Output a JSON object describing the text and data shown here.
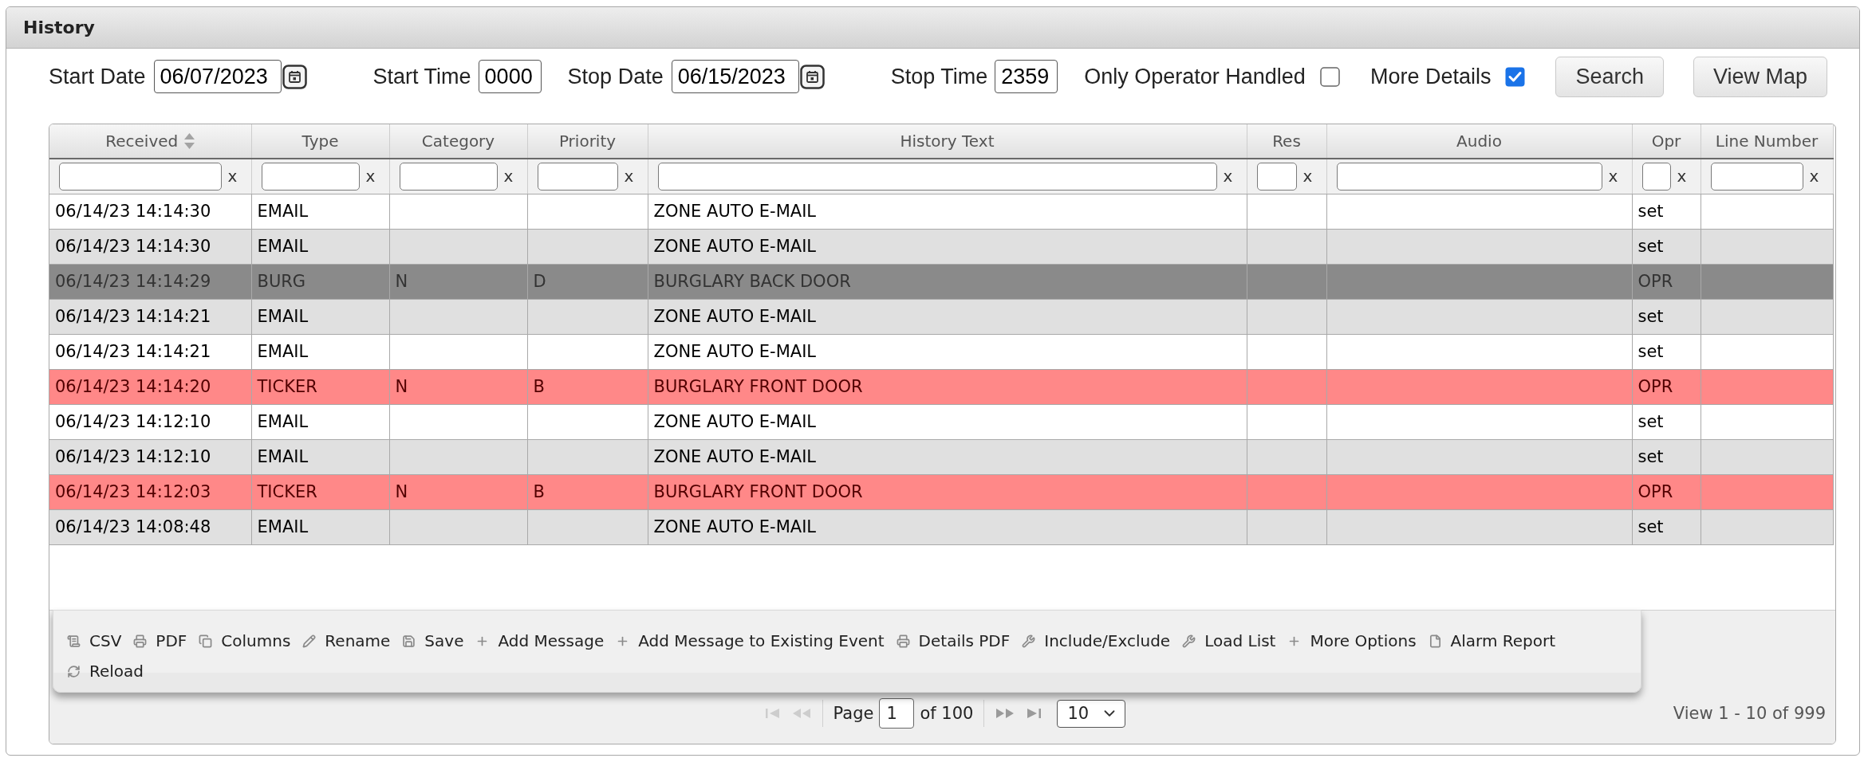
{
  "panel": {
    "title": "History"
  },
  "filters": [
    {
      "kind": "date",
      "label": "Start Date",
      "value": "06/07/2023"
    },
    {
      "kind": "time",
      "label": "Start Time",
      "value": "0000"
    },
    {
      "kind": "date",
      "label": "Stop Date",
      "value": "06/15/2023"
    },
    {
      "kind": "time",
      "label": "Stop Time",
      "value": "2359"
    },
    {
      "kind": "checkbox",
      "label": "Only Operator Handled",
      "checked": false
    },
    {
      "kind": "checkbox",
      "label": "More Details",
      "checked": true
    }
  ],
  "buttons": [
    "Search",
    "View Map"
  ],
  "table": {
    "columns": [
      {
        "label": "Received",
        "sortable": true,
        "clear": "x"
      },
      {
        "label": "Type",
        "sortable": false,
        "clear": "x"
      },
      {
        "label": "Category",
        "sortable": false,
        "clear": "x"
      },
      {
        "label": "Priority",
        "sortable": false,
        "clear": "x"
      },
      {
        "label": "History Text",
        "sortable": false,
        "clear": "x"
      },
      {
        "label": "Res",
        "sortable": false,
        "clear": "x"
      },
      {
        "label": "Audio",
        "sortable": false,
        "clear": "x"
      },
      {
        "label": "Opr",
        "sortable": false,
        "clear": "x"
      },
      {
        "label": "Line Number",
        "sortable": false,
        "clear": "x"
      }
    ],
    "rows": [
      {
        "kind": "message",
        "selected": false,
        "received": "06/14/23 14:14:30",
        "type": "EMAIL",
        "history_text": "ZONE AUTO E-MAIL",
        "opr": "set"
      },
      {
        "kind": "message",
        "selected": false,
        "received": "06/14/23 14:14:30",
        "type": "EMAIL",
        "history_text": "ZONE AUTO E-MAIL",
        "opr": "set"
      },
      {
        "selected": true,
        "received": "06/14/23 14:14:29",
        "type": "BURG",
        "category": "N",
        "priority": "D",
        "history_text": "BURGLARY BACK DOOR",
        "opr": "OPR"
      },
      {
        "kind": "message",
        "selected": false,
        "received": "06/14/23 14:14:21",
        "type": "EMAIL",
        "history_text": "ZONE AUTO E-MAIL",
        "opr": "set"
      },
      {
        "kind": "message",
        "selected": false,
        "received": "06/14/23 14:14:21",
        "type": "EMAIL",
        "history_text": "ZONE AUTO E-MAIL",
        "opr": "set"
      },
      {
        "kind": "alarm",
        "selected": false,
        "received": "06/14/23 14:14:20",
        "type": "TICKER",
        "category": "N",
        "priority": "B",
        "history_text": "BURGLARY FRONT DOOR",
        "opr": "OPR"
      },
      {
        "kind": "message",
        "selected": false,
        "received": "06/14/23 14:12:10",
        "type": "EMAIL",
        "history_text": "ZONE AUTO E-MAIL",
        "opr": "set"
      },
      {
        "kind": "message",
        "selected": false,
        "received": "06/14/23 14:12:10",
        "type": "EMAIL",
        "history_text": "ZONE AUTO E-MAIL",
        "opr": "set"
      },
      {
        "kind": "alarm",
        "selected": false,
        "received": "06/14/23 14:12:03",
        "type": "TICKER",
        "category": "N",
        "priority": "B",
        "history_text": "BURGLARY FRONT DOOR",
        "opr": "OPR"
      },
      {
        "kind": "message",
        "selected": false,
        "received": "06/14/23 14:08:48",
        "type": "EMAIL",
        "history_text": "ZONE AUTO E-MAIL",
        "opr": "set"
      }
    ]
  },
  "toolbar": [
    {
      "kind": "export",
      "label": "CSV"
    },
    {
      "kind": "print",
      "label": "PDF"
    },
    {
      "kind": "columns",
      "label": "Columns"
    },
    {
      "kind": "edit",
      "label": "Rename"
    },
    {
      "kind": "save",
      "label": "Save"
    },
    {
      "kind": "add",
      "label": "Add Message"
    },
    {
      "kind": "add",
      "label": "Add Message to Existing Event"
    },
    {
      "kind": "print",
      "label": "Details PDF"
    },
    {
      "kind": "tool",
      "label": "Include/Exclude"
    },
    {
      "kind": "tool",
      "label": "Load List"
    },
    {
      "kind": "add",
      "label": "More Options"
    },
    {
      "kind": "report",
      "label": "Alarm Report"
    },
    {
      "kind": "reload",
      "label": "Reload"
    }
  ],
  "pager": {
    "nav": [
      {
        "kind": "first",
        "disabled": true
      },
      {
        "kind": "prev",
        "disabled": true
      },
      {
        "kind": "next",
        "disabled": false
      },
      {
        "kind": "last",
        "disabled": false
      }
    ],
    "page_label": "Page",
    "page": "1",
    "page_count": "of 100",
    "page_size": "10",
    "summary": "View 1 - 10 of 999"
  }
}
